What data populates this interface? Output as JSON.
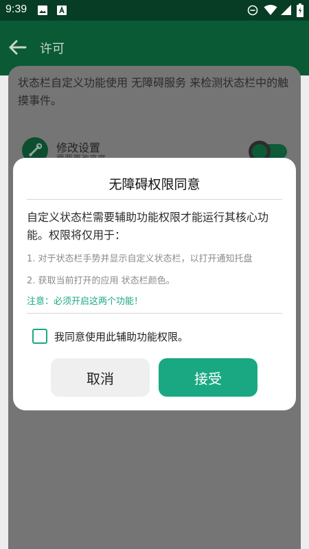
{
  "status_bar": {
    "time": "9:39",
    "left_icons": [
      "image-icon",
      "font-icon"
    ],
    "right_icons": [
      "do-not-disturb-icon",
      "wifi-icon",
      "signal-icon",
      "battery-icon"
    ]
  },
  "app_bar": {
    "title": "许可",
    "back_icon": "arrow-left-icon"
  },
  "content": {
    "description": "状态栏自定义功能使用 无障碍服务 来检测状态栏中的触摸事件。",
    "row": {
      "icon": "settings-icon",
      "title": "修改设置",
      "subtitle": "需要更改亮度"
    }
  },
  "dialog": {
    "title": "无障碍权限同意",
    "body": "自定义状态栏需要辅助功能权限才能运行其核心功能。权限将仅用于：",
    "points": [
      "1. 对于状态栏手势并显示自定义状态栏，以打开通知托盘",
      "2. 获取当前打开的应用 状态栏颜色。"
    ],
    "note": "注意：必须开启这两个功能！",
    "checkbox_label": "我同意使用此辅助功能权限。",
    "cancel_label": "取消",
    "accept_label": "接受"
  },
  "colors": {
    "accent": "#1aa882",
    "app_bar": "#0a5a36",
    "status_bar": "#063d24"
  }
}
